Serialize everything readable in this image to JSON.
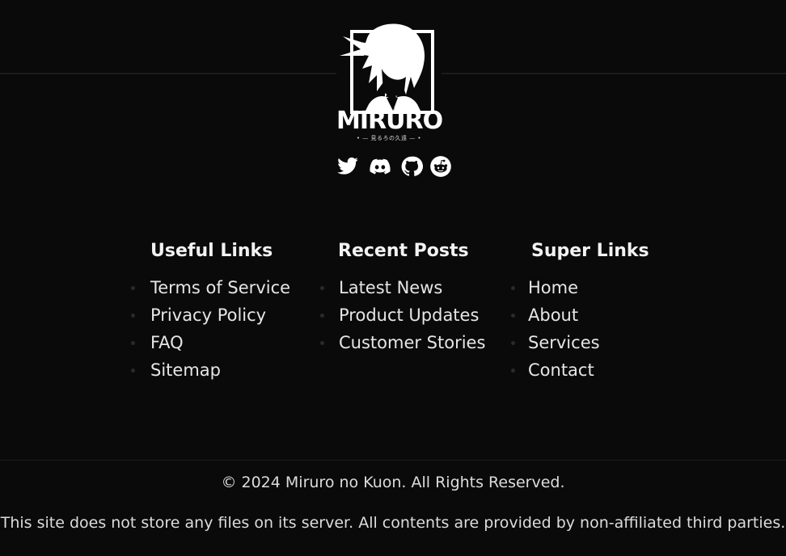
{
  "logo": {
    "word": "MIRURO",
    "subtitle": "• — 見るろの久遠 — •"
  },
  "socials": [
    {
      "icon": "twitter-icon"
    },
    {
      "icon": "discord-icon"
    },
    {
      "icon": "github-icon"
    },
    {
      "icon": "reddit-icon"
    }
  ],
  "columns": {
    "useful": {
      "title": "Useful Links",
      "items": [
        "Terms of Service",
        "Privacy Policy",
        "FAQ",
        "Sitemap"
      ]
    },
    "recent": {
      "title": "Recent Posts",
      "items": [
        "Latest News",
        "Product Updates",
        "Customer Stories"
      ]
    },
    "super": {
      "title": "Super Links",
      "items": [
        "Home",
        "About",
        "Services",
        "Contact"
      ]
    }
  },
  "footer": {
    "copyright": "© 2024 Miruro no Kuon. All Rights Reserved.",
    "disclaimer": "This site does not store any files on its server. All contents are provided by non-affiliated third parties."
  },
  "colors": {
    "background": "#0a0a0b",
    "text": "#e6e6e6",
    "accent": "#ffffff"
  }
}
